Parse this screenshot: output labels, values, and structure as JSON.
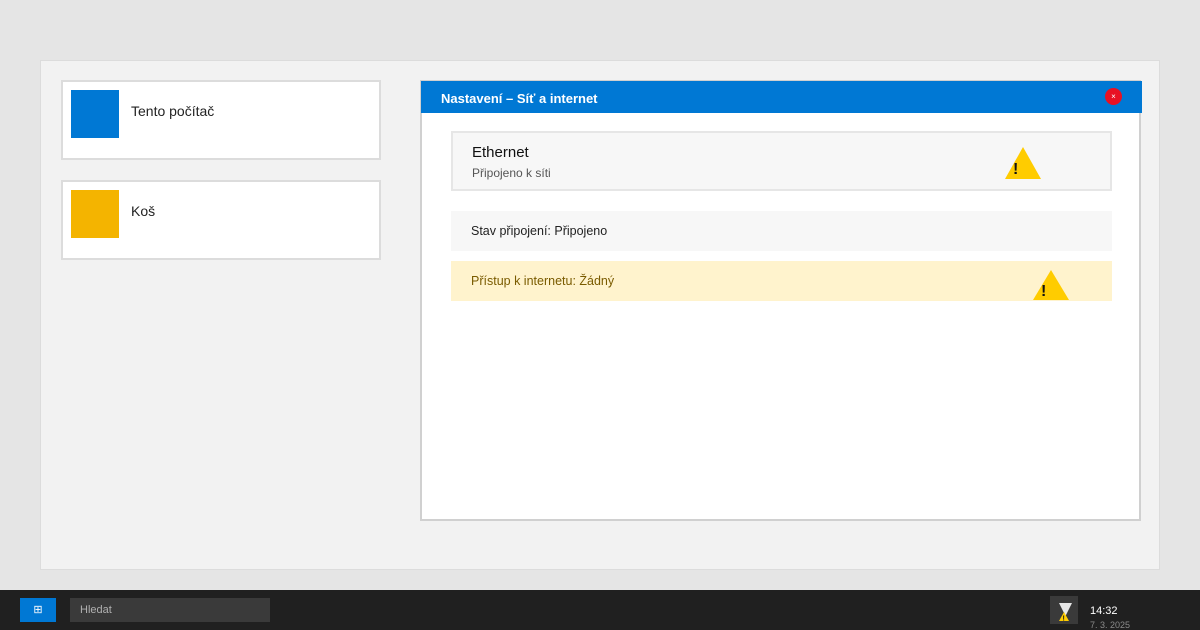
{
  "desktop": {
    "icons": [
      {
        "label": "Tento počítač",
        "color": "#0078d4"
      },
      {
        "label": "Koš",
        "color": "#f4b400"
      }
    ]
  },
  "window": {
    "title": "Nastavení – Síť a internet",
    "close_glyph": "×",
    "ethernet": {
      "name": "Ethernet",
      "status": "Připojeno k síti",
      "icon": "warning-icon"
    },
    "connection_state": "Stav připojení: Připojeno",
    "internet_access": "Přístup k internetu: Žádný"
  },
  "taskbar": {
    "start_glyph": "⊞",
    "search_placeholder": "Hledat",
    "time": "14:32",
    "date": "7. 3. 2025",
    "tray_icon": "network-warning-icon"
  },
  "colors": {
    "accent": "#0078d4",
    "close": "#e81123",
    "warning": "#ffcc00",
    "warning_row_bg": "#fff3cd"
  }
}
